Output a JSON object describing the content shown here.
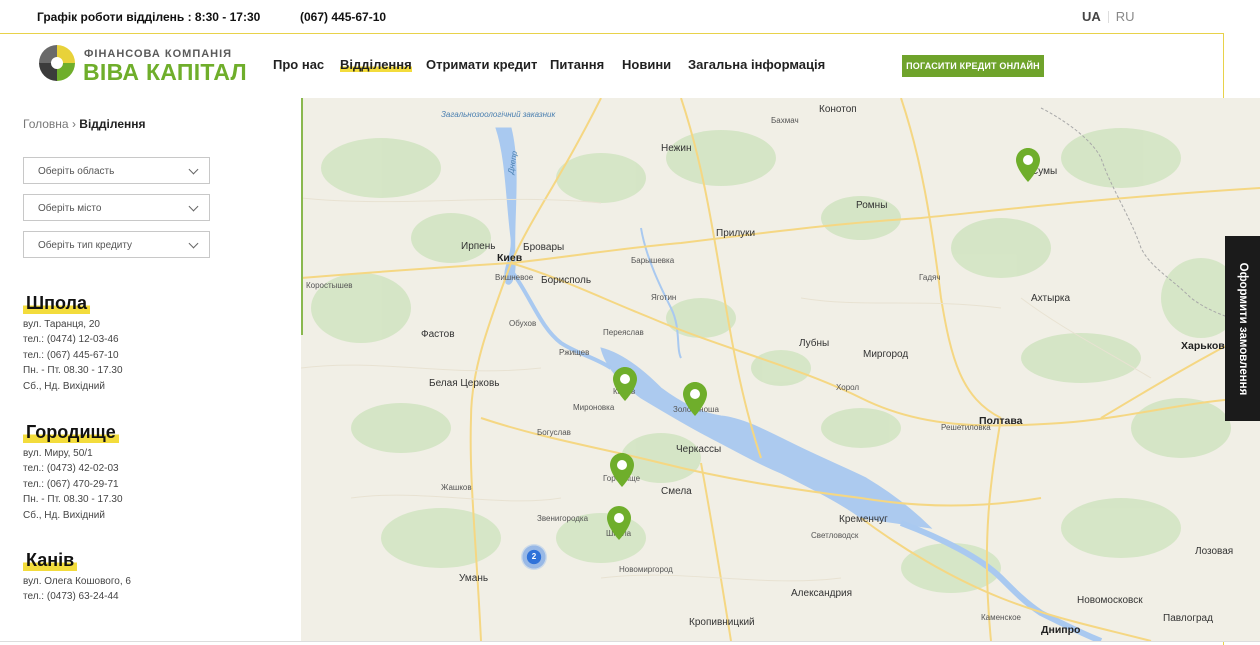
{
  "topbar": {
    "schedule": "Графік роботи відділень :  8:30 - 17:30",
    "phone": "(067) 445-67-10",
    "lang_active": "UA",
    "lang_other": "RU"
  },
  "logo": {
    "line1": "ФІНАНСОВА КОМПАНІЯ",
    "line2": "ВІВА КАПІТАЛ",
    "colors": {
      "green": "#6fae2b",
      "yellow": "#e8d23a",
      "dark": "#3b3b3b"
    }
  },
  "nav": {
    "items": [
      {
        "label": "Про нас"
      },
      {
        "label": "Відділення"
      },
      {
        "label": "Отримати кредит"
      },
      {
        "label": "Питання"
      },
      {
        "label": "Новини"
      },
      {
        "label": "Загальна інформація"
      }
    ],
    "pay_button": "ПОГАСИТИ КРЕДИТ ОНЛАЙН"
  },
  "breadcrumb": {
    "home": "Головна",
    "sep": "›",
    "current": "Відділення"
  },
  "filters": {
    "region": "Оберіть область",
    "city": "Оберіть місто",
    "credit_type": "Оберіть тип кредиту"
  },
  "branches": [
    {
      "name": "Шпола",
      "lines": [
        "вул. Таранця, 20",
        "тел.: (0474) 12-03-46",
        "тел.: (067) 445-67-10",
        "Пн. - Пт. 08.30 - 17.30",
        "Сб., Нд. Вихідний"
      ]
    },
    {
      "name": "Городище",
      "lines": [
        "вул. Миру, 50/1",
        "тел.: (0473) 42-02-03",
        "тел.: (067) 470-29-71",
        "Пн. - Пт. 08.30 - 17.30",
        "Сб., Нд. Вихідний"
      ]
    },
    {
      "name": "Канів",
      "lines": [
        "вул. Олега Кошового, 6",
        "тел.: (0473) 63-24-44"
      ]
    }
  ],
  "map": {
    "cluster_count": "2",
    "labels": {
      "kiev": "Киев",
      "brovary": "Бровары",
      "vyshnevoe": "Вишневое",
      "borispol": "Борисполь",
      "belaya": "Белая Церковь",
      "fastov": "Фастов",
      "irpen": "Ирпень",
      "obukhov": "Обухов",
      "rzhyshchiv": "Ржищев",
      "pereyaslav": "Переяслав",
      "yagotin": "Яготин",
      "pryluky": "Прилуки",
      "nizhyn": "Нежин",
      "romny": "Ромны",
      "sumy": "Сумы",
      "lubny": "Лубны",
      "myrhorod": "Миргород",
      "poltava": "Полтава",
      "kharkov": "Харьков",
      "akhtyrka": "Ахтырка",
      "cherkasy": "Черкассы",
      "smila": "Смела",
      "kremenchug": "Кременчуг",
      "svetlovodsk": "Светловодск",
      "uman": "Умань",
      "kropyvnytskyi": "Кропивницкий",
      "dnipro": "Днипро",
      "novomoskovsk": "Новомосковск",
      "pavlograd": "Павлоград",
      "lozovaya": "Лозовая",
      "oleksandria": "Александрия",
      "zolotonosha": "Золотоноша",
      "kaniv": "Канев",
      "horodyshche": "Городище",
      "shpola": "Шпола",
      "myronivka": "Мироновка",
      "novomyrhorod": "Новомиргород",
      "zvenyhorodka": "Звенигородка",
      "khorol": "Хорол",
      "konotop": "Конотоп",
      "baryshivka": "Барышевка",
      "dnepr_river": "Днепр",
      "zakaznik": "Загальнозоологічний заказник",
      "korostyshev": "Коростышев",
      "bohuslav": "Богуслав",
      "kamianske": "Каменское",
      "reshetylivka": "Решетиловка",
      "hadiach": "Гадяч",
      "bakhmach": "Бахмач",
      "zhashkiv": "Жашков"
    }
  },
  "order_tab": "Оформити замовлення"
}
